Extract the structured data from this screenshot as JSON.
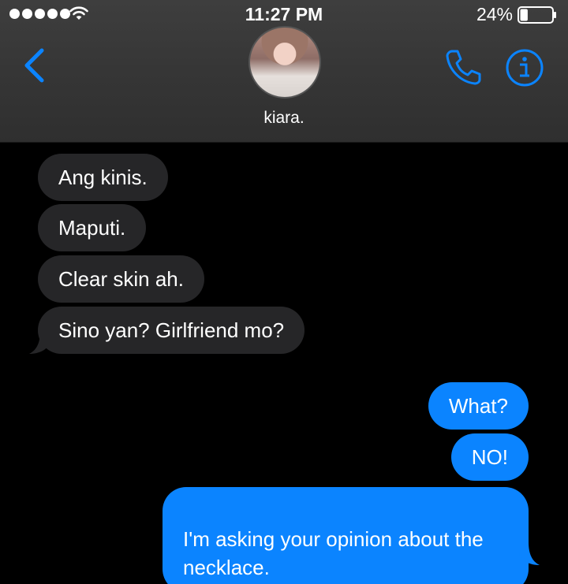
{
  "status_bar": {
    "time": "11:27 PM",
    "battery_percent": "24%",
    "battery_level": 0.24,
    "signal_dots": 5
  },
  "header": {
    "contact_name": "kiara.",
    "icons": [
      "back-chevron-icon",
      "phone-icon",
      "info-icon"
    ],
    "accent_color": "#0b84ff"
  },
  "messages": [
    {
      "direction": "incoming",
      "text": "Ang kinis."
    },
    {
      "direction": "incoming",
      "text": "Maputi."
    },
    {
      "direction": "incoming",
      "text": "Clear skin ah."
    },
    {
      "direction": "incoming",
      "text": "Sino yan? Girlfriend mo?"
    },
    {
      "direction": "outgoing",
      "text": "What?"
    },
    {
      "direction": "outgoing",
      "text": "NO!"
    },
    {
      "direction": "outgoing",
      "text": "I'm asking your opinion about the\nnecklace."
    }
  ],
  "colors": {
    "incoming_bubble": "#262628",
    "outgoing_bubble": "#0b84ff",
    "background": "#000000"
  }
}
